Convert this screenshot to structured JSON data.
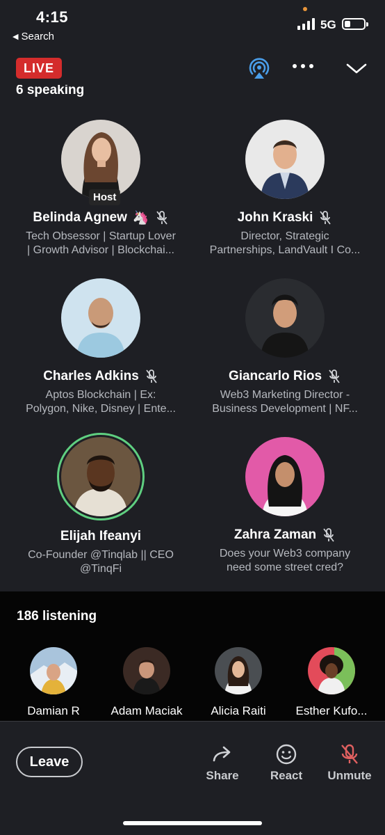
{
  "status_bar": {
    "time": "4:15",
    "back_label": "Search",
    "network": "5G"
  },
  "header": {
    "live_label": "LIVE",
    "icons": [
      "airplay-icon",
      "more-icon",
      "chevron-down-icon"
    ]
  },
  "speaking": {
    "count_label": "6 speaking",
    "host_label": "Host",
    "speakers": [
      {
        "name": "Belinda Agnew",
        "emoji": "🦄",
        "muted": true,
        "host": true,
        "bio1": "Tech Obsessor | Startup Lover",
        "bio2": "| Growth Advisor | Blockchai..."
      },
      {
        "name": "John Kraski",
        "emoji": "",
        "muted": true,
        "host": false,
        "bio1": "Director, Strategic",
        "bio2": "Partnerships, LandVault I Co..."
      },
      {
        "name": "Charles Adkins",
        "emoji": "",
        "muted": true,
        "host": false,
        "bio1": "Aptos Blockchain | Ex:",
        "bio2": "Polygon, Nike, Disney | Ente..."
      },
      {
        "name": "Giancarlo Rios",
        "emoji": "",
        "muted": true,
        "host": false,
        "bio1": "Web3 Marketing Director -",
        "bio2": "Business Development | NF..."
      },
      {
        "name": "Elijah Ifeanyi",
        "emoji": "",
        "muted": false,
        "host": false,
        "bio1": "Co-Founder @Tinqlab || CEO",
        "bio2": "@TinqFi"
      },
      {
        "name": "Zahra Zaman",
        "emoji": "",
        "muted": true,
        "host": false,
        "bio1": "Does your Web3 company",
        "bio2": "need some street cred?"
      }
    ]
  },
  "listening": {
    "count_label": "186 listening",
    "listeners": [
      {
        "name": "Damian R"
      },
      {
        "name": "Adam Maciak"
      },
      {
        "name": "Alicia Raiti"
      },
      {
        "name": "Esther Kufo..."
      }
    ]
  },
  "bottom_bar": {
    "leave_label": "Leave",
    "share_label": "Share",
    "react_label": "React",
    "unmute_label": "Unmute"
  },
  "colors": {
    "background": "#1e1f24",
    "live_red": "#d42c2c",
    "speaking_ring": "#5fcf80",
    "muted_red": "#e06060",
    "accent_blue": "#4a9eea"
  }
}
